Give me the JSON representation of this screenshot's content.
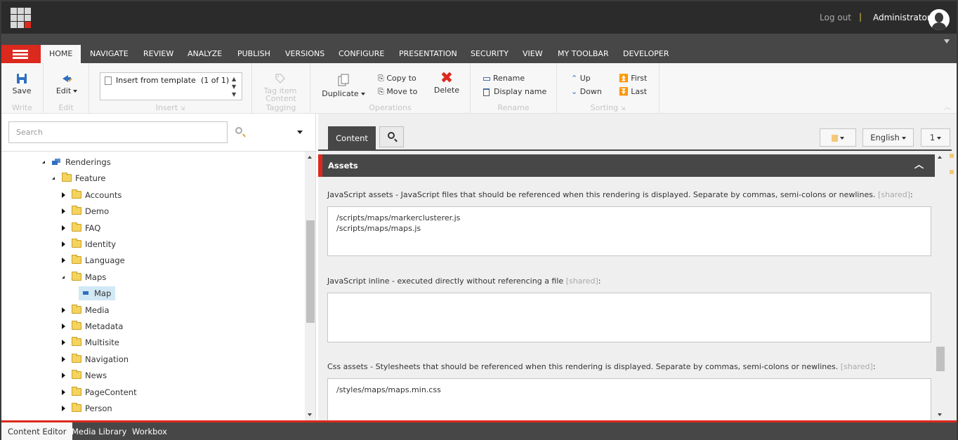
{
  "header": {
    "logout": "Log out",
    "separator": "|",
    "user": "Administrator"
  },
  "ribbon_tabs": [
    "HOME",
    "NAVIGATE",
    "REVIEW",
    "ANALYZE",
    "PUBLISH",
    "VERSIONS",
    "CONFIGURE",
    "PRESENTATION",
    "SECURITY",
    "VIEW",
    "MY TOOLBAR",
    "DEVELOPER"
  ],
  "active_ribbon_tab": "HOME",
  "ribbon": {
    "write": {
      "label": "Write",
      "save": "Save"
    },
    "edit": {
      "label": "Edit",
      "edit": "Edit"
    },
    "insert": {
      "label": "Insert",
      "item": "Insert from template",
      "count": "(1 of 1)"
    },
    "tagging": {
      "label": "Content Tagging",
      "tag_item": "Tag item"
    },
    "operations": {
      "label": "Operations",
      "duplicate": "Duplicate",
      "copy_to": "Copy to",
      "move_to": "Move to",
      "delete": "Delete"
    },
    "rename": {
      "label": "Rename",
      "rename": "Rename",
      "display_name": "Display name"
    },
    "sorting": {
      "label": "Sorting",
      "up": "Up",
      "down": "Down",
      "first": "First",
      "last": "Last"
    }
  },
  "tree": {
    "search_placeholder": "Search",
    "nodes": [
      {
        "label": "Renderings",
        "level": 0,
        "state": "expanded",
        "icon": "renderings-icon"
      },
      {
        "label": "Feature",
        "level": 1,
        "state": "expanded",
        "icon": "feature-folder-icon"
      },
      {
        "label": "Accounts",
        "level": 2,
        "state": "collapsed",
        "icon": "folder-icon"
      },
      {
        "label": "Demo",
        "level": 2,
        "state": "collapsed",
        "icon": "folder-icon"
      },
      {
        "label": "FAQ",
        "level": 2,
        "state": "collapsed",
        "icon": "folder-icon"
      },
      {
        "label": "Identity",
        "level": 2,
        "state": "collapsed",
        "icon": "folder-icon"
      },
      {
        "label": "Language",
        "level": 2,
        "state": "collapsed",
        "icon": "folder-icon"
      },
      {
        "label": "Maps",
        "level": 2,
        "state": "expanded",
        "icon": "folder-icon"
      },
      {
        "label": "Map",
        "level": 3,
        "state": "leaf",
        "icon": "rendering-icon",
        "selected": true
      },
      {
        "label": "Media",
        "level": 2,
        "state": "collapsed",
        "icon": "folder-icon"
      },
      {
        "label": "Metadata",
        "level": 2,
        "state": "collapsed",
        "icon": "folder-icon"
      },
      {
        "label": "Multisite",
        "level": 2,
        "state": "collapsed",
        "icon": "folder-icon"
      },
      {
        "label": "Navigation",
        "level": 2,
        "state": "collapsed",
        "icon": "folder-icon"
      },
      {
        "label": "News",
        "level": 2,
        "state": "collapsed",
        "icon": "folder-icon"
      },
      {
        "label": "PageContent",
        "level": 2,
        "state": "collapsed",
        "icon": "folder-icon"
      },
      {
        "label": "Person",
        "level": 2,
        "state": "collapsed",
        "icon": "folder-icon"
      }
    ]
  },
  "editor": {
    "content_tab": "Content",
    "language": "English",
    "version": "1",
    "section_title": "Assets",
    "fields": [
      {
        "label": "JavaScript assets - JavaScript files that should be referenced when this rendering is displayed. Separate by commas, semi-colons or newlines.",
        "shared": "[shared]",
        "value": "/scripts/maps/markerclusterer.js\n/scripts/maps/maps.js"
      },
      {
        "label": "JavaScript inline - executed directly without referencing a file",
        "shared": "[shared]",
        "value": ""
      },
      {
        "label": "Css assets - Stylesheets that should be referenced when this rendering is displayed. Separate by commas, semi-colons or newlines.",
        "shared": "[shared]",
        "value": "/styles/maps/maps.min.css"
      }
    ]
  },
  "bottom_tabs": [
    "Content Editor",
    "Media Library",
    "Workbox"
  ],
  "active_bottom_tab": "Content Editor",
  "colors": {
    "accent": "#dc291e",
    "dark": "#2b2b2b",
    "tab_bar": "#474747",
    "selection": "#d2e9f5"
  }
}
